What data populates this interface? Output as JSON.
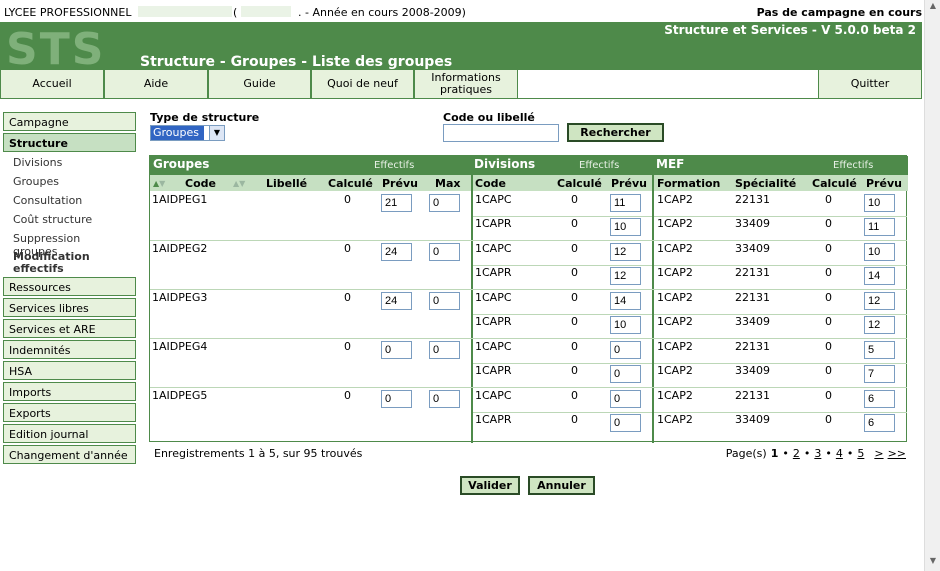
{
  "top": {
    "school": "LYCEE PROFESSIONNEL",
    "open_paren": "(",
    "year": ". - Année en cours 2008-2009)",
    "campaign": "Pas de campagne en cours"
  },
  "banner": {
    "logo": "STS",
    "app_title": "Structure et Services - V 5.0.0 beta 2",
    "page_title": "Structure - Groupes - Liste des groupes"
  },
  "nav": {
    "items": [
      "Accueil",
      "Aide",
      "Guide",
      "Quoi de neuf",
      "Informations pratiques"
    ],
    "quit": "Quitter"
  },
  "sidebar": {
    "before": [
      "Campagne"
    ],
    "active": "Structure",
    "subitems": [
      "Divisions",
      "Groupes",
      "Consultation",
      "Coût structure",
      "Suppression groupes"
    ],
    "current_sub": "Modification effectifs",
    "after": [
      "Ressources",
      "Services libres",
      "Services et ARE",
      "Indemnités",
      "HSA",
      "Imports",
      "Exports",
      "Edition journal",
      "Changement d'année"
    ]
  },
  "filters": {
    "type_label": "Type de structure",
    "type_value": "Groupes",
    "code_label": "Code ou libellé",
    "code_value": "",
    "search_label": "Rechercher"
  },
  "table": {
    "groupes": {
      "title": "Groupes",
      "effectifs": "Effectifs",
      "cols": [
        "Code",
        "Libellé",
        "Calculé",
        "Prévu",
        "Max"
      ]
    },
    "divisions": {
      "title": "Divisions",
      "effectifs": "Effectifs",
      "cols": [
        "Code",
        "Calculé",
        "Prévu"
      ]
    },
    "mef": {
      "title": "MEF",
      "effectifs": "Effectifs",
      "cols": [
        "Formation",
        "Spécialité",
        "Calculé",
        "Prévu"
      ]
    },
    "rows": [
      {
        "code": "1AIDPEG1",
        "calc": "0",
        "prevu": "21",
        "max": "0",
        "subs": [
          {
            "div": "1CAPC",
            "dcalc": "0",
            "dprevu": "11",
            "form": "1CAP2",
            "spec": "22131",
            "mcalc": "0",
            "mprevu": "10"
          },
          {
            "div": "1CAPR",
            "dcalc": "0",
            "dprevu": "10",
            "form": "1CAP2",
            "spec": "33409",
            "mcalc": "0",
            "mprevu": "11"
          }
        ]
      },
      {
        "code": "1AIDPEG2",
        "calc": "0",
        "prevu": "24",
        "max": "0",
        "subs": [
          {
            "div": "1CAPC",
            "dcalc": "0",
            "dprevu": "12",
            "form": "1CAP2",
            "spec": "33409",
            "mcalc": "0",
            "mprevu": "10"
          },
          {
            "div": "1CAPR",
            "dcalc": "0",
            "dprevu": "12",
            "form": "1CAP2",
            "spec": "22131",
            "mcalc": "0",
            "mprevu": "14"
          }
        ]
      },
      {
        "code": "1AIDPEG3",
        "calc": "0",
        "prevu": "24",
        "max": "0",
        "subs": [
          {
            "div": "1CAPC",
            "dcalc": "0",
            "dprevu": "14",
            "form": "1CAP2",
            "spec": "22131",
            "mcalc": "0",
            "mprevu": "12"
          },
          {
            "div": "1CAPR",
            "dcalc": "0",
            "dprevu": "10",
            "form": "1CAP2",
            "spec": "33409",
            "mcalc": "0",
            "mprevu": "12"
          }
        ]
      },
      {
        "code": "1AIDPEG4",
        "calc": "0",
        "prevu": "0",
        "max": "0",
        "subs": [
          {
            "div": "1CAPC",
            "dcalc": "0",
            "dprevu": "0",
            "form": "1CAP2",
            "spec": "22131",
            "mcalc": "0",
            "mprevu": "5"
          },
          {
            "div": "1CAPR",
            "dcalc": "0",
            "dprevu": "0",
            "form": "1CAP2",
            "spec": "33409",
            "mcalc": "0",
            "mprevu": "7"
          }
        ]
      },
      {
        "code": "1AIDPEG5",
        "calc": "0",
        "prevu": "0",
        "max": "0",
        "subs": [
          {
            "div": "1CAPC",
            "dcalc": "0",
            "dprevu": "0",
            "form": "1CAP2",
            "spec": "22131",
            "mcalc": "0",
            "mprevu": "6"
          },
          {
            "div": "1CAPR",
            "dcalc": "0",
            "dprevu": "0",
            "form": "1CAP2",
            "spec": "33409",
            "mcalc": "0",
            "mprevu": "6"
          }
        ]
      }
    ]
  },
  "footer": {
    "records": "Enregistrements 1 à 5, sur 95 trouvés",
    "pages_label": "Page(s)",
    "pages": [
      "1",
      "2",
      "3",
      "4",
      "5"
    ],
    "next": ">",
    "last": ">>"
  },
  "actions": {
    "validate": "Valider",
    "cancel": "Annuler"
  },
  "colors": {
    "brand_green": "#4e8a4a",
    "light_green": "#e7f2dd",
    "header_green": "#c6e0c2"
  },
  "icons": {
    "sort_up": "sort-up-icon",
    "sort_down": "sort-down-icon",
    "dropdown": "chevron-down-icon"
  }
}
